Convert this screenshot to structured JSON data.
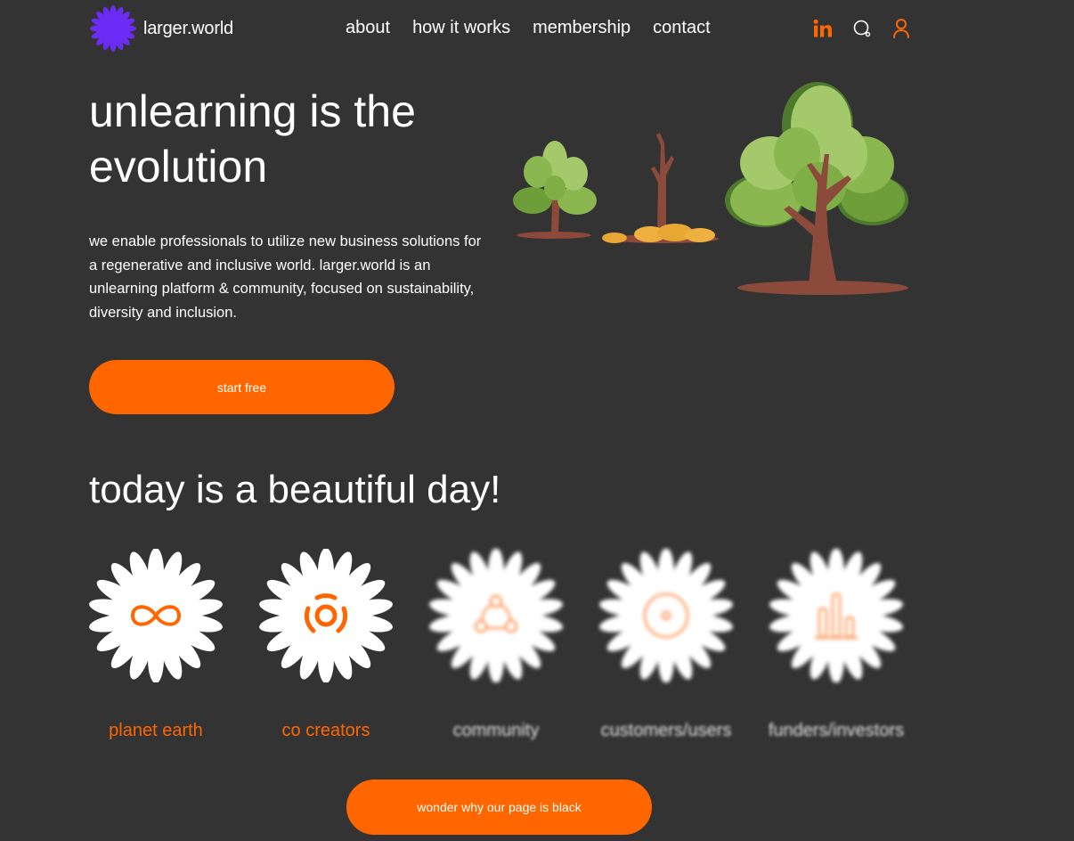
{
  "brand": {
    "name": "larger.world",
    "logo_icon": "asterisk-flower-logo-icon",
    "logo_color": "#6B2CF5"
  },
  "nav": {
    "items": [
      {
        "label": "about"
      },
      {
        "label": "how it works"
      },
      {
        "label": "membership"
      },
      {
        "label": "contact"
      }
    ]
  },
  "header_icons": {
    "linkedin": "linkedin-icon",
    "search": "search-icon",
    "account": "user-icon",
    "accent": "#FF6600"
  },
  "hero": {
    "title": "unlearning is the evolution",
    "description": "we enable professionals to utilize new business solutions for a regenerative and inclusive world. larger.world is an unlearning platform & community, focused on sustainability, diversity and inclusion.",
    "cta_label": "start free",
    "illustration": "three-trees-illustration"
  },
  "stakeholders": {
    "title": "today is a beautiful day!",
    "items": [
      {
        "label": "planet earth",
        "icon": "infinity-icon",
        "state": "active"
      },
      {
        "label": "co creators",
        "icon": "circle-segments-icon",
        "state": "active"
      },
      {
        "label": "community",
        "icon": "three-nodes-icon",
        "state": "blurred"
      },
      {
        "label": "customers/users",
        "icon": "target-icon",
        "state": "blurred"
      },
      {
        "label": "funders/investors",
        "icon": "bar-chart-icon",
        "state": "blurred"
      }
    ]
  },
  "footer_cta": {
    "label": "wonder why our page is black"
  },
  "colors": {
    "background": "#333333",
    "accent": "#FF6600",
    "text": "#FFFFFF"
  }
}
